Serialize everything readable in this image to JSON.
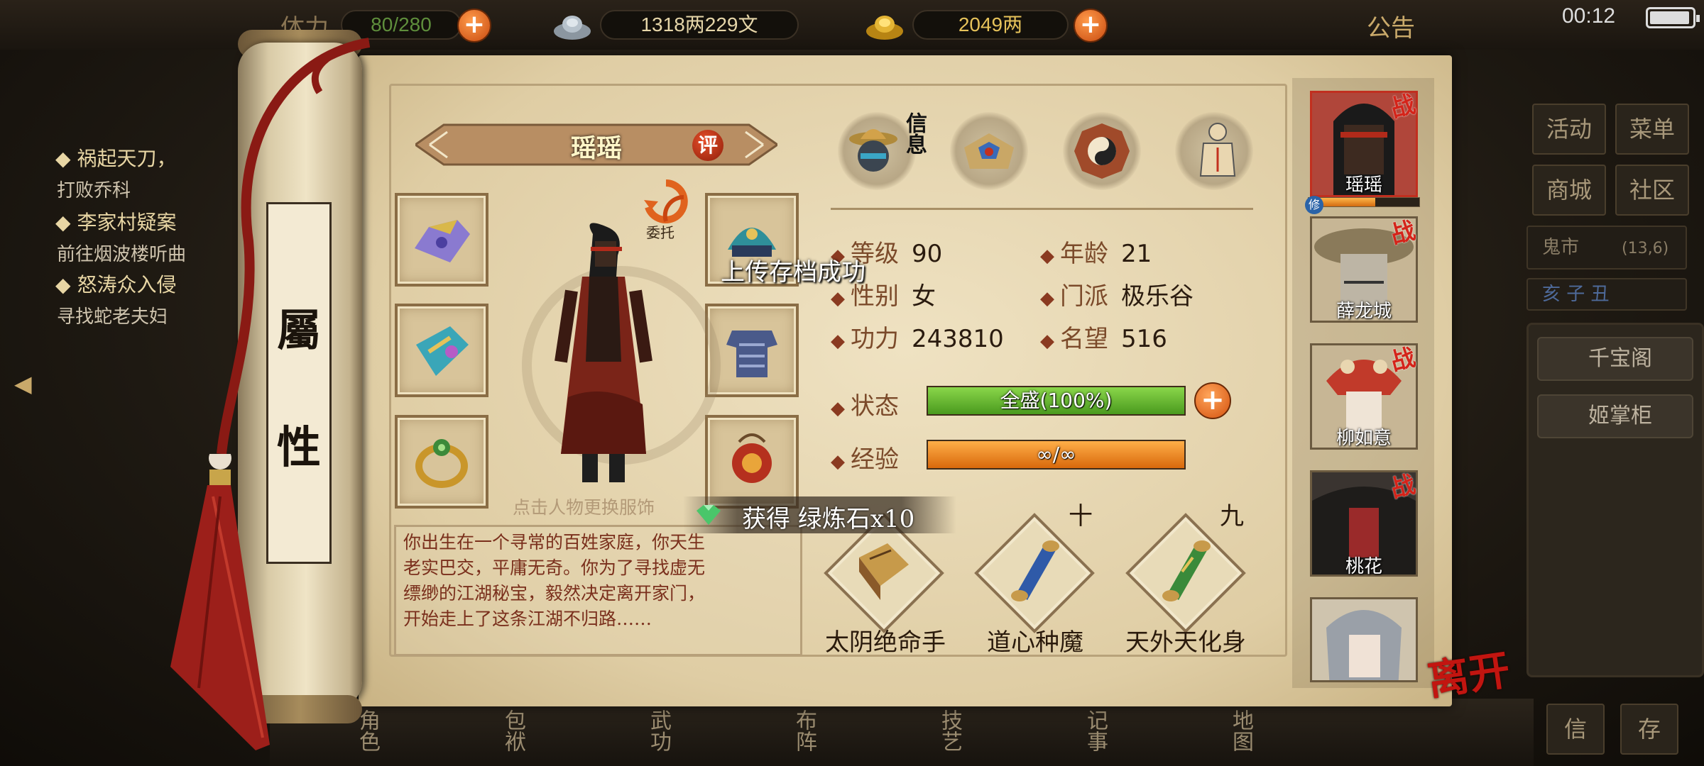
{
  "topbar": {
    "stamina_label": "体力",
    "stamina": "80/280",
    "money": "1318两229文",
    "gold": "2049两",
    "notice": "公告",
    "time": "00:12",
    "battery_level": 0.95
  },
  "quests": [
    {
      "title": "祸起天刀，",
      "desc": "打败乔科"
    },
    {
      "title": "李家村疑案",
      "desc": "前往烟波楼听曲"
    },
    {
      "title": "怒涛众入侵",
      "desc": "寻找蛇老夫妇"
    }
  ],
  "quest_bullet": "◆",
  "right_menu": {
    "activity": "活动",
    "menu": "菜单",
    "mall": "商城",
    "community": "社区",
    "ghost_market": "鬼市",
    "coords": "(13,6)",
    "time_zodiac": "亥 子 丑",
    "treasure_pavilion": "千宝阁",
    "shopkeeper": "姬掌柜",
    "btn_letter": "信",
    "btn_save": "存"
  },
  "bottom_nav": [
    {
      "label": "角色"
    },
    {
      "label": "包袱"
    },
    {
      "label": "武功"
    },
    {
      "label": "布阵"
    },
    {
      "label": "技艺"
    },
    {
      "label": "记事"
    },
    {
      "label": "地图"
    }
  ],
  "scroll": {
    "title_top": "屬",
    "title_bottom": "性"
  },
  "character": {
    "name": "瑶瑶",
    "eval_button": "评",
    "delegate": "委托",
    "change_outfit_hint": "点击人物更换服饰",
    "bio": [
      "你出生在一个寻常的百姓家庭，你天生",
      "老实巴交，平庸无奇。你为了寻找虚无",
      "缥缈的江湖秘宝，毅然决定离开家门，",
      "开始走上了这条江湖不归路……"
    ]
  },
  "tabs": {
    "info_label": "信息",
    "icons": [
      "info-icon",
      "book-icon",
      "bagua-icon",
      "meridian-icon"
    ]
  },
  "stats": {
    "level_label": "等级",
    "level": "90",
    "age_label": "年龄",
    "age": "21",
    "gender_label": "性别",
    "gender": "女",
    "sect_label": "门派",
    "sect": "极乐谷",
    "power_label": "功力",
    "power": "243810",
    "fame_label": "名望",
    "fame": "516",
    "status_label": "状态",
    "status": "全盛(100%)",
    "status_value": 1.0,
    "exp_label": "经验",
    "exp": "∞/∞",
    "exp_value": 1.0
  },
  "toasts": {
    "upload": "上传存档成功",
    "obtained": "获得 绿炼石x10"
  },
  "skills": [
    {
      "name": "太阴绝命手",
      "level": ""
    },
    {
      "name": "道心种魔",
      "level": "十"
    },
    {
      "name": "天外天化身",
      "level": "九"
    }
  ],
  "party": [
    {
      "name": "瑶瑶",
      "tag": "战"
    },
    {
      "name": "薛龙城",
      "tag": "战"
    },
    {
      "name": "柳如意",
      "tag": "战"
    },
    {
      "name": "桃花",
      "tag": "战"
    },
    {
      "name": "",
      "tag": ""
    }
  ],
  "party_cultivate_badge": "修",
  "party_cultivate_level": 0.6,
  "leave_label": "离开",
  "colors": {
    "accent_red": "#c21510",
    "hp_green": "#5fb12a",
    "exp_orange": "#f08a1e"
  }
}
